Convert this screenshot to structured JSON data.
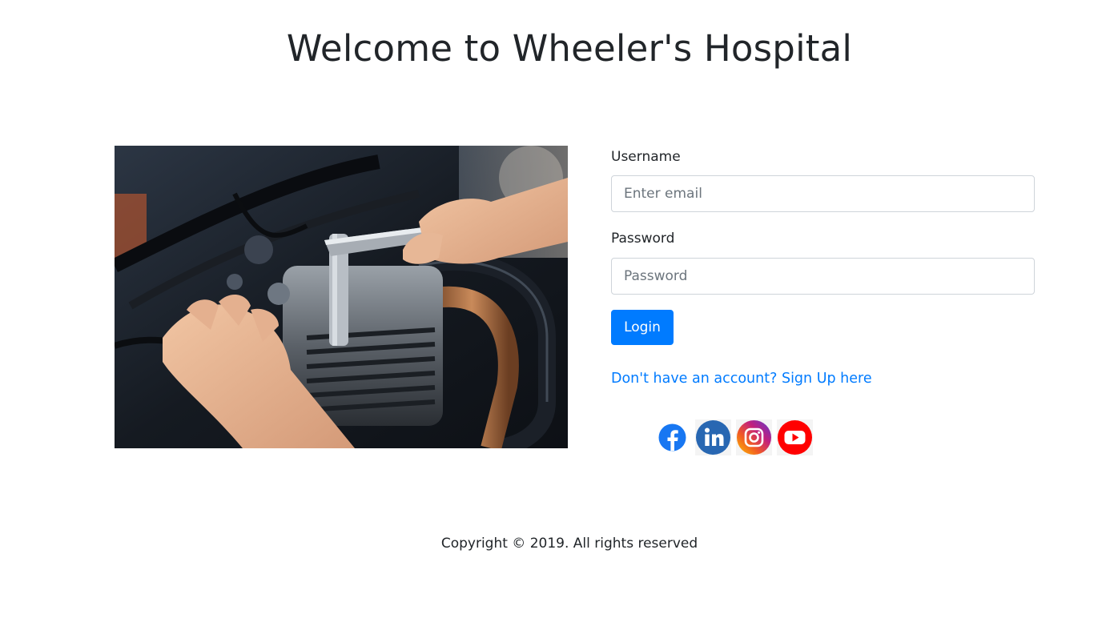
{
  "header": {
    "title": "Welcome to Wheeler's Hospital"
  },
  "hero_image": {
    "description_icon": "motorcycle-engine-repair-photo"
  },
  "login_form": {
    "username_label": "Username",
    "username_placeholder": "Enter email",
    "username_value": "",
    "password_label": "Password",
    "password_placeholder": "Password",
    "password_value": "",
    "login_button": "Login",
    "signup_link": "Don't have an account? Sign Up here"
  },
  "social": [
    {
      "name": "facebook-icon",
      "color": "#1877f2"
    },
    {
      "name": "linkedin-icon",
      "color": "#2867b2"
    },
    {
      "name": "instagram-icon",
      "color": "#c13584"
    },
    {
      "name": "youtube-icon",
      "color": "#ff0000"
    }
  ],
  "footer": {
    "copyright": "Copyright © 2019. All rights reserved"
  },
  "colors": {
    "primary": "#007bff",
    "text": "#212529",
    "input_border": "#ced4da"
  }
}
